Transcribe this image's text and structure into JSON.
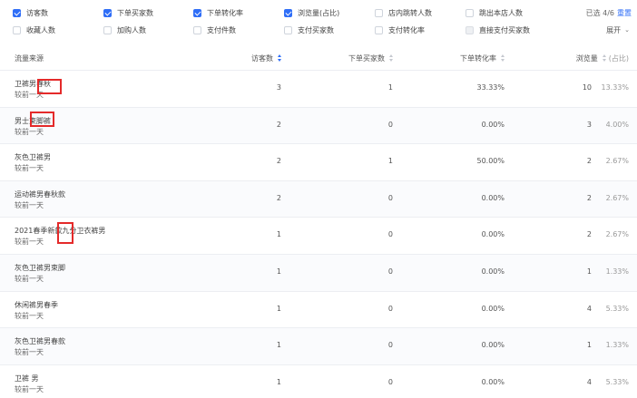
{
  "filters": {
    "row1": [
      {
        "label": "访客数",
        "checked": true
      },
      {
        "label": "下单买家数",
        "checked": true
      },
      {
        "label": "下单转化率",
        "checked": true
      },
      {
        "label": "浏览量(占比)",
        "checked": true
      },
      {
        "label": "店内跳转人数",
        "checked": false
      },
      {
        "label": "跳出本店人数",
        "checked": false
      }
    ],
    "row2": [
      {
        "label": "收藏人数",
        "checked": false
      },
      {
        "label": "加购人数",
        "checked": false
      },
      {
        "label": "支付件数",
        "checked": false
      },
      {
        "label": "支付买家数",
        "checked": false
      },
      {
        "label": "支付转化率",
        "checked": false
      },
      {
        "label": "直接支付买家数",
        "checked": false,
        "disabled": true
      }
    ],
    "selected_text": "已选 4/6",
    "reset_label": "重置",
    "expand_label": "展开"
  },
  "table": {
    "headers": {
      "source": "流量来源",
      "visitors": "访客数",
      "buyers": "下单买家数",
      "rate": "下单转化率",
      "pv": "浏览量",
      "pv_share": "(占比)"
    },
    "rows": [
      {
        "name": "卫裤男春秋",
        "compare": "较前一天",
        "visitors": "3",
        "buyers": "1",
        "rate": "33.33%",
        "pv": "10",
        "share": "13.33%"
      },
      {
        "name": "男士束脚裤",
        "compare": "较前一天",
        "visitors": "2",
        "buyers": "0",
        "rate": "0.00%",
        "pv": "3",
        "share": "4.00%"
      },
      {
        "name": "灰色卫裤男",
        "compare": "较前一天",
        "visitors": "2",
        "buyers": "1",
        "rate": "50.00%",
        "pv": "2",
        "share": "2.67%"
      },
      {
        "name": "运动裤男春秋款",
        "compare": "较前一天",
        "visitors": "2",
        "buyers": "0",
        "rate": "0.00%",
        "pv": "2",
        "share": "2.67%"
      },
      {
        "name": "2021春季新款九分卫衣裤男",
        "compare": "较前一天",
        "visitors": "1",
        "buyers": "0",
        "rate": "0.00%",
        "pv": "2",
        "share": "2.67%"
      },
      {
        "name": "灰色卫裤男束脚",
        "compare": "较前一天",
        "visitors": "1",
        "buyers": "0",
        "rate": "0.00%",
        "pv": "1",
        "share": "1.33%"
      },
      {
        "name": "休闲裤男春季",
        "compare": "较前一天",
        "visitors": "1",
        "buyers": "0",
        "rate": "0.00%",
        "pv": "4",
        "share": "5.33%"
      },
      {
        "name": "灰色卫裤男春款",
        "compare": "较前一天",
        "visitors": "1",
        "buyers": "0",
        "rate": "0.00%",
        "pv": "1",
        "share": "1.33%"
      },
      {
        "name": "卫裤 男",
        "compare": "较前一天",
        "visitors": "1",
        "buyers": "0",
        "rate": "0.00%",
        "pv": "4",
        "share": "5.33%"
      }
    ]
  },
  "colors": {
    "accent": "#2f6ef7",
    "highlight": "#e42a2a"
  }
}
